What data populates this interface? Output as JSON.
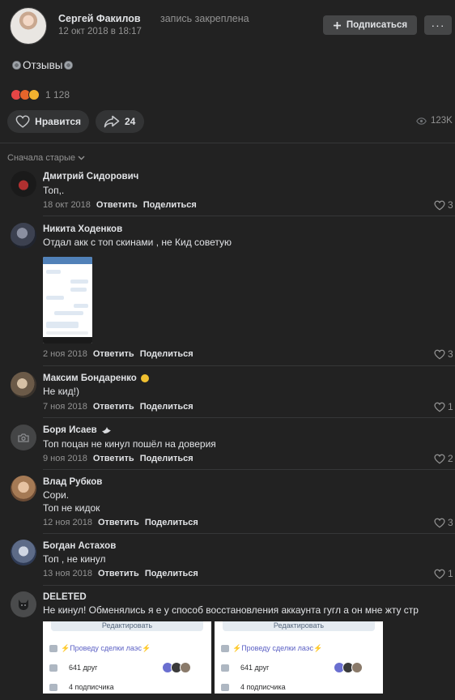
{
  "post": {
    "author": "Сергей Факилов",
    "pinned_note": "запись закреплена",
    "date": "12 окт 2018 в 18:17",
    "subscribe_label": "Подписаться",
    "more_label": "···",
    "text": "Отзывы",
    "reaction_count": "1 128",
    "like_label": "Нравится",
    "share_count": "24",
    "views": "123K"
  },
  "comments_header": {
    "sort_label": "Сначала старые"
  },
  "comment_actions": {
    "reply": "Ответить",
    "share": "Поделиться"
  },
  "comments": [
    {
      "name": "Дмитрий Сидорович",
      "text": "Топ,.",
      "date": "18 окт 2018",
      "likes": "3"
    },
    {
      "name": "Никита Ходенков",
      "text": "Отдал акк с топ скинами , не Кид советую",
      "date": "2 ноя 2018",
      "likes": "3"
    },
    {
      "name": "Максим Бондаренко",
      "text": "Не кид!)",
      "date": "7 ноя 2018",
      "likes": "1"
    },
    {
      "name": "Боря Исаев",
      "text": "Топ поцан не кинул пошёл на доверия",
      "date": "9 ноя 2018",
      "likes": "2"
    },
    {
      "name": "Влад Рубков",
      "text_line1": "Сори.",
      "text_line2": "Топ не кидок",
      "date": "12 ноя 2018",
      "likes": "3"
    },
    {
      "name": "Богдан Астахов",
      "text": "Топ , не кинул",
      "date": "13 ноя 2018",
      "likes": "1"
    },
    {
      "name": "DELETED",
      "text": "Не кинул! Обменялись я е у способ восстановления аккаунта гугл а он мне жту стр"
    }
  ],
  "screenshots": {
    "edit_label": "Редактировать",
    "status_text": "⚡Проведу сделки лаэс⚡",
    "friends_label": "641 друг",
    "followers_label": "4 подписчика"
  },
  "colors": {
    "background": "#222222",
    "button": "#454647",
    "text": "#e1e3e6",
    "muted": "#939393"
  }
}
